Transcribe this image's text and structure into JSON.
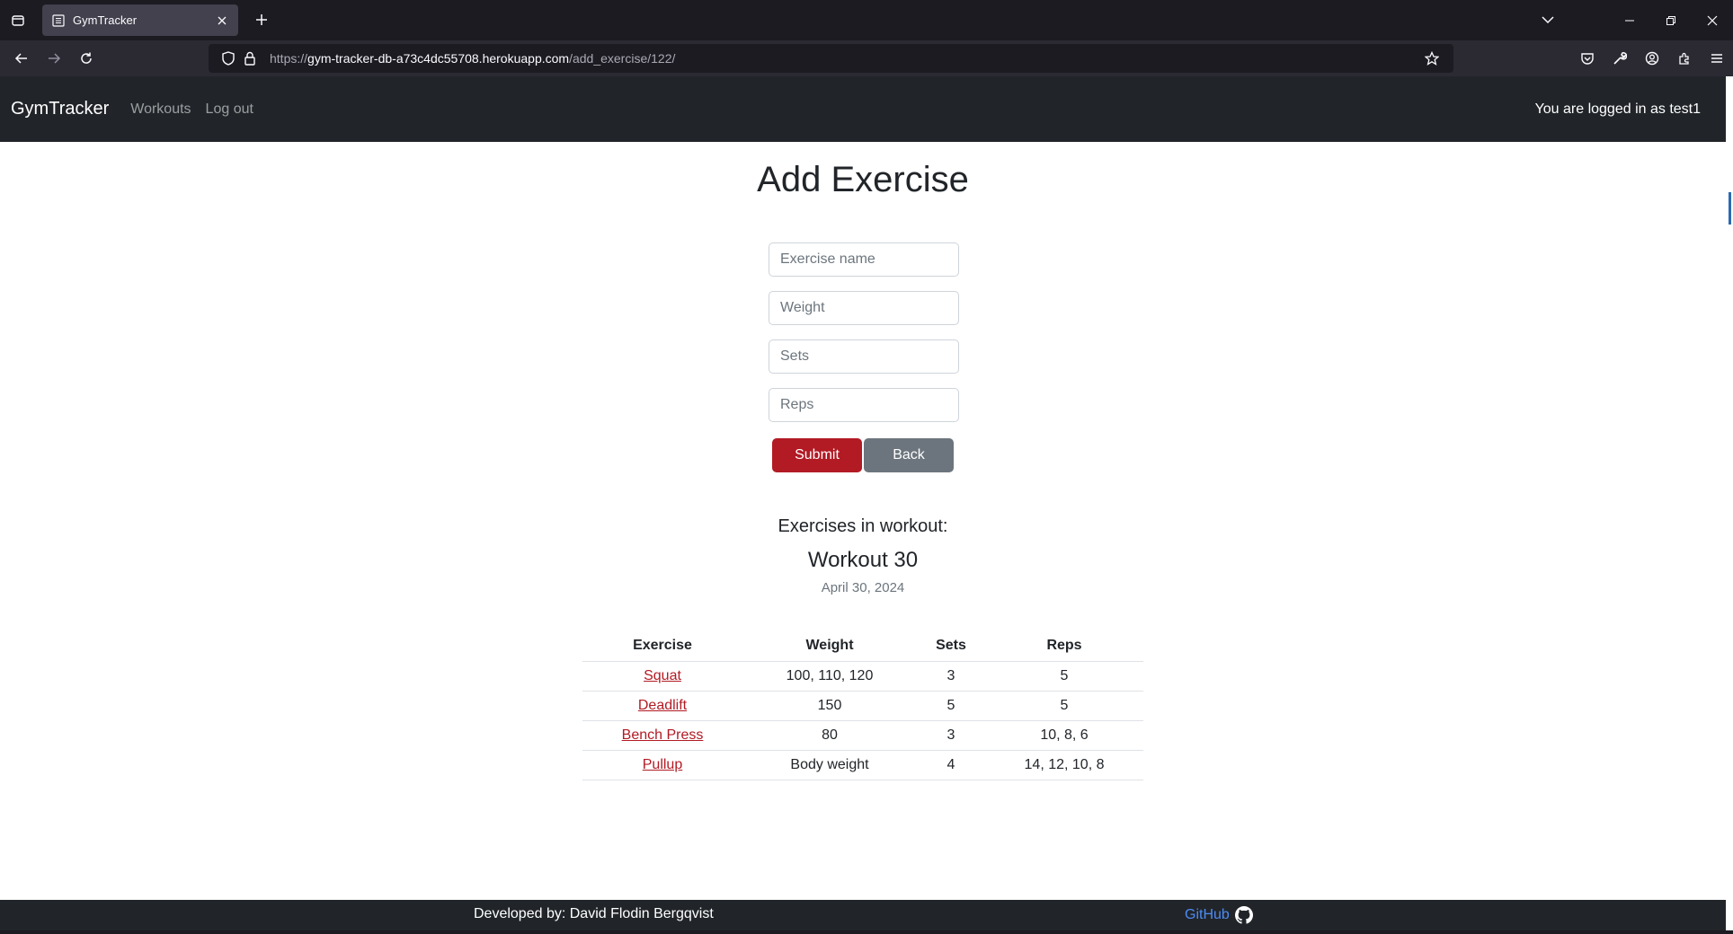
{
  "browser": {
    "tab_title": "GymTracker",
    "url_scheme": "https://",
    "url_host": "gym-tracker-db-a73c4dc55708.herokuapp.com",
    "url_path": "/add_exercise/122/"
  },
  "nav": {
    "brand": "GymTracker",
    "links": [
      "Workouts",
      "Log out"
    ],
    "status": "You are logged in as test1"
  },
  "page": {
    "title": "Add Exercise",
    "form": {
      "exercise_placeholder": "Exercise name",
      "weight_placeholder": "Weight",
      "sets_placeholder": "Sets",
      "reps_placeholder": "Reps",
      "submit_label": "Submit",
      "back_label": "Back"
    },
    "section_heading": "Exercises in workout:",
    "workout_name": "Workout 30",
    "workout_date": "April 30, 2024",
    "table": {
      "headers": [
        "Exercise",
        "Weight",
        "Sets",
        "Reps"
      ],
      "rows": [
        [
          "Squat",
          "100, 110, 120",
          "3",
          "5"
        ],
        [
          "Deadlift",
          "150",
          "5",
          "5"
        ],
        [
          "Bench Press",
          "80",
          "3",
          "10, 8, 6"
        ],
        [
          "Pullup",
          "Body weight",
          "4",
          "14, 12, 10, 8"
        ]
      ]
    }
  },
  "footer": {
    "developer": "Developed by: David Flodin Bergqvist",
    "github_label": "GitHub"
  },
  "colors": {
    "navbar": "#212529",
    "accent_red": "#b21a24",
    "back_grey": "#6c757d",
    "github_link": "#4d8bf5"
  }
}
